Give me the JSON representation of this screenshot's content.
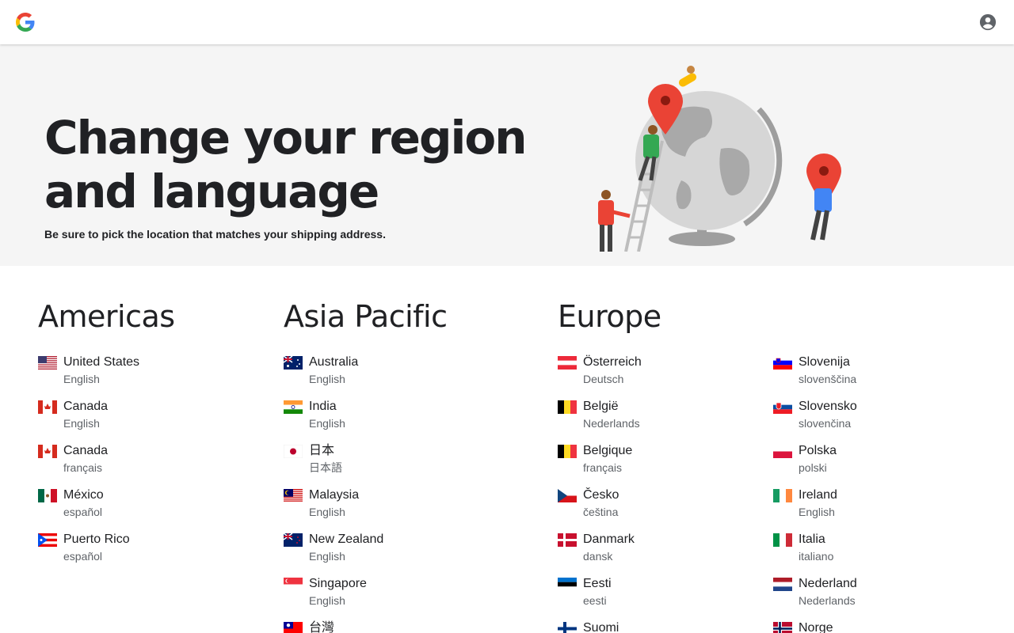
{
  "header": {
    "logo_icon": "google-g-logo",
    "account_icon": "account-circle-icon"
  },
  "hero": {
    "title": "Change your region and language",
    "subtitle": "Be sure to pick the location that matches your shipping address."
  },
  "regions": {
    "americas": {
      "title": "Americas",
      "items": [
        {
          "country": "United States",
          "language": "English",
          "flag": "us"
        },
        {
          "country": "Canada",
          "language": "English",
          "flag": "ca"
        },
        {
          "country": "Canada",
          "language": "français",
          "flag": "ca"
        },
        {
          "country": "México",
          "language": "español",
          "flag": "mx"
        },
        {
          "country": "Puerto Rico",
          "language": "español",
          "flag": "pr"
        }
      ]
    },
    "asia_pacific": {
      "title": "Asia Pacific",
      "items": [
        {
          "country": "Australia",
          "language": "English",
          "flag": "au"
        },
        {
          "country": "India",
          "language": "English",
          "flag": "in"
        },
        {
          "country": "日本",
          "language": "日本語",
          "flag": "jp"
        },
        {
          "country": "Malaysia",
          "language": "English",
          "flag": "my"
        },
        {
          "country": "New Zealand",
          "language": "English",
          "flag": "nz"
        },
        {
          "country": "Singapore",
          "language": "English",
          "flag": "sg"
        },
        {
          "country": "台灣",
          "language": "",
          "flag": "tw"
        }
      ]
    },
    "europe": {
      "title": "Europe",
      "items_col1": [
        {
          "country": "Österreich",
          "language": "Deutsch",
          "flag": "at"
        },
        {
          "country": "België",
          "language": "Nederlands",
          "flag": "be"
        },
        {
          "country": "Belgique",
          "language": "français",
          "flag": "be"
        },
        {
          "country": "Česko",
          "language": "čeština",
          "flag": "cz"
        },
        {
          "country": "Danmark",
          "language": "dansk",
          "flag": "dk"
        },
        {
          "country": "Eesti",
          "language": "eesti",
          "flag": "ee"
        },
        {
          "country": "Suomi",
          "language": "",
          "flag": "fi"
        }
      ],
      "items_col2": [
        {
          "country": "Slovenija",
          "language": "slovenščina",
          "flag": "si"
        },
        {
          "country": "Slovensko",
          "language": "slovenčina",
          "flag": "sk"
        },
        {
          "country": "Polska",
          "language": "polski",
          "flag": "pl"
        },
        {
          "country": "Ireland",
          "language": "English",
          "flag": "ie"
        },
        {
          "country": "Italia",
          "language": "italiano",
          "flag": "it"
        },
        {
          "country": "Nederland",
          "language": "Nederlands",
          "flag": "nl"
        },
        {
          "country": "Norge",
          "language": "",
          "flag": "no"
        }
      ]
    }
  },
  "colors": {
    "hero_bg": "#f5f5f5",
    "text": "#202124",
    "secondary_text": "#5f6368",
    "pin_red": "#ea4335"
  }
}
